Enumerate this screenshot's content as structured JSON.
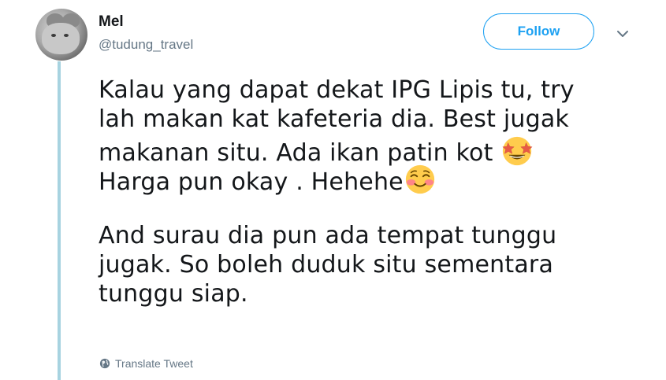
{
  "user": {
    "name": "Mel",
    "handle": "@tudung_travel",
    "avatar_icon": "cat-avatar"
  },
  "header": {
    "follow_label": "Follow",
    "menu_icon": "chevron-down-icon"
  },
  "tweet": {
    "paragraph1": {
      "line1": "Kalau yang dapat dekat IPG Lipis tu, try",
      "line2": "lah makan kat kafeteria dia. Best jugak",
      "line3": "makanan situ. Ada ikan patin kot ",
      "line4": "Harga pun okay . Hehehe"
    },
    "paragraph2": {
      "line1": "And surau dia pun ada tempat tunggu",
      "line2": "jugak. So boleh duduk situ sementara",
      "line3": "tunggu siap."
    },
    "emojis": [
      "star-struck-emoji",
      "smiling-face-emoji"
    ]
  },
  "footer": {
    "translate_label": "Translate Tweet",
    "translate_icon": "globe-icon"
  },
  "colors": {
    "accent": "#1da1f2",
    "thread_line": "#a7d3e0",
    "secondary_text": "#657786",
    "primary_text": "#14171a"
  }
}
